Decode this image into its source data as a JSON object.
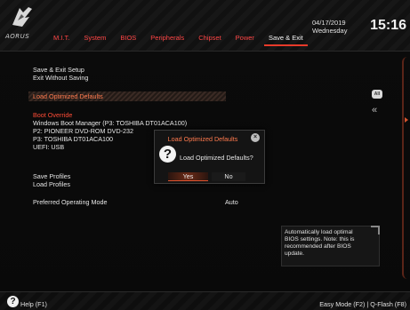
{
  "header": {
    "brand": "AORUS",
    "tabs": [
      {
        "label": "M.I.T."
      },
      {
        "label": "System"
      },
      {
        "label": "BIOS"
      },
      {
        "label": "Peripherals"
      },
      {
        "label": "Chipset"
      },
      {
        "label": "Power"
      },
      {
        "label": "Save & Exit"
      }
    ],
    "active_tab": "Save & Exit",
    "date": "04/17/2019",
    "weekday": "Wednesday",
    "time": "15:16"
  },
  "main": {
    "save_exit_setup": "Save & Exit Setup",
    "exit_without_saving": "Exit Without Saving",
    "load_optimized_defaults": "Load Optimized Defaults",
    "boot_override": "Boot Override",
    "boot_devices": [
      "Windows Boot Manager (P3: TOSHIBA DT01ACA100)",
      "P2: PIONEER DVD-ROM DVD-232",
      "P3: TOSHIBA DT01ACA100",
      "UEFI: USB"
    ],
    "save_profiles": "Save Profiles",
    "load_profiles": "Load Profiles",
    "preferred_mode_label": "Preferred Operating Mode",
    "preferred_mode_value": "Auto"
  },
  "side": {
    "all_badge": "All",
    "collapse_glyph": "«"
  },
  "helpbox": {
    "text_lines": [
      "Automatically load optimal",
      "BIOS settings. Note: this is",
      "recommended after BIOS",
      "update."
    ]
  },
  "dialog": {
    "title": "Load Optimized Defaults",
    "message": "Load Optimized Defaults?",
    "yes_label": "Yes",
    "no_label": "No",
    "close_glyph": "×",
    "question_glyph": "?"
  },
  "footer": {
    "help_glyph": "?",
    "help_label": "Help (F1)",
    "right_text": "Easy Mode (F2)  |  Q-Flash (F8)"
  },
  "colors": {
    "accent": "#e83a2a",
    "hot_text": "#ff4c36",
    "highlight_text": "#ff7a4e",
    "background": "#0a0a0a"
  }
}
